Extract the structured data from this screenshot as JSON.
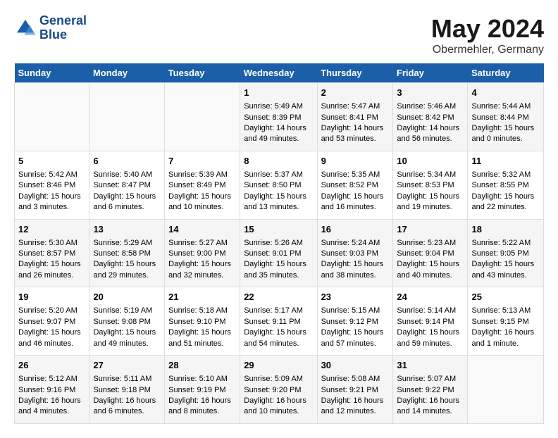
{
  "header": {
    "logo_line1": "General",
    "logo_line2": "Blue",
    "title": "May 2024",
    "subtitle": "Obermehler, Germany"
  },
  "weekdays": [
    "Sunday",
    "Monday",
    "Tuesday",
    "Wednesday",
    "Thursday",
    "Friday",
    "Saturday"
  ],
  "weeks": [
    [
      {
        "day": "",
        "content": ""
      },
      {
        "day": "",
        "content": ""
      },
      {
        "day": "",
        "content": ""
      },
      {
        "day": "1",
        "content": "Sunrise: 5:49 AM\nSunset: 8:39 PM\nDaylight: 14 hours\nand 49 minutes."
      },
      {
        "day": "2",
        "content": "Sunrise: 5:47 AM\nSunset: 8:41 PM\nDaylight: 14 hours\nand 53 minutes."
      },
      {
        "day": "3",
        "content": "Sunrise: 5:46 AM\nSunset: 8:42 PM\nDaylight: 14 hours\nand 56 minutes."
      },
      {
        "day": "4",
        "content": "Sunrise: 5:44 AM\nSunset: 8:44 PM\nDaylight: 15 hours\nand 0 minutes."
      }
    ],
    [
      {
        "day": "5",
        "content": "Sunrise: 5:42 AM\nSunset: 8:46 PM\nDaylight: 15 hours\nand 3 minutes."
      },
      {
        "day": "6",
        "content": "Sunrise: 5:40 AM\nSunset: 8:47 PM\nDaylight: 15 hours\nand 6 minutes."
      },
      {
        "day": "7",
        "content": "Sunrise: 5:39 AM\nSunset: 8:49 PM\nDaylight: 15 hours\nand 10 minutes."
      },
      {
        "day": "8",
        "content": "Sunrise: 5:37 AM\nSunset: 8:50 PM\nDaylight: 15 hours\nand 13 minutes."
      },
      {
        "day": "9",
        "content": "Sunrise: 5:35 AM\nSunset: 8:52 PM\nDaylight: 15 hours\nand 16 minutes."
      },
      {
        "day": "10",
        "content": "Sunrise: 5:34 AM\nSunset: 8:53 PM\nDaylight: 15 hours\nand 19 minutes."
      },
      {
        "day": "11",
        "content": "Sunrise: 5:32 AM\nSunset: 8:55 PM\nDaylight: 15 hours\nand 22 minutes."
      }
    ],
    [
      {
        "day": "12",
        "content": "Sunrise: 5:30 AM\nSunset: 8:57 PM\nDaylight: 15 hours\nand 26 minutes."
      },
      {
        "day": "13",
        "content": "Sunrise: 5:29 AM\nSunset: 8:58 PM\nDaylight: 15 hours\nand 29 minutes."
      },
      {
        "day": "14",
        "content": "Sunrise: 5:27 AM\nSunset: 9:00 PM\nDaylight: 15 hours\nand 32 minutes."
      },
      {
        "day": "15",
        "content": "Sunrise: 5:26 AM\nSunset: 9:01 PM\nDaylight: 15 hours\nand 35 minutes."
      },
      {
        "day": "16",
        "content": "Sunrise: 5:24 AM\nSunset: 9:03 PM\nDaylight: 15 hours\nand 38 minutes."
      },
      {
        "day": "17",
        "content": "Sunrise: 5:23 AM\nSunset: 9:04 PM\nDaylight: 15 hours\nand 40 minutes."
      },
      {
        "day": "18",
        "content": "Sunrise: 5:22 AM\nSunset: 9:05 PM\nDaylight: 15 hours\nand 43 minutes."
      }
    ],
    [
      {
        "day": "19",
        "content": "Sunrise: 5:20 AM\nSunset: 9:07 PM\nDaylight: 15 hours\nand 46 minutes."
      },
      {
        "day": "20",
        "content": "Sunrise: 5:19 AM\nSunset: 9:08 PM\nDaylight: 15 hours\nand 49 minutes."
      },
      {
        "day": "21",
        "content": "Sunrise: 5:18 AM\nSunset: 9:10 PM\nDaylight: 15 hours\nand 51 minutes."
      },
      {
        "day": "22",
        "content": "Sunrise: 5:17 AM\nSunset: 9:11 PM\nDaylight: 15 hours\nand 54 minutes."
      },
      {
        "day": "23",
        "content": "Sunrise: 5:15 AM\nSunset: 9:12 PM\nDaylight: 15 hours\nand 57 minutes."
      },
      {
        "day": "24",
        "content": "Sunrise: 5:14 AM\nSunset: 9:14 PM\nDaylight: 15 hours\nand 59 minutes."
      },
      {
        "day": "25",
        "content": "Sunrise: 5:13 AM\nSunset: 9:15 PM\nDaylight: 16 hours\nand 1 minute."
      }
    ],
    [
      {
        "day": "26",
        "content": "Sunrise: 5:12 AM\nSunset: 9:16 PM\nDaylight: 16 hours\nand 4 minutes."
      },
      {
        "day": "27",
        "content": "Sunrise: 5:11 AM\nSunset: 9:18 PM\nDaylight: 16 hours\nand 6 minutes."
      },
      {
        "day": "28",
        "content": "Sunrise: 5:10 AM\nSunset: 9:19 PM\nDaylight: 16 hours\nand 8 minutes."
      },
      {
        "day": "29",
        "content": "Sunrise: 5:09 AM\nSunset: 9:20 PM\nDaylight: 16 hours\nand 10 minutes."
      },
      {
        "day": "30",
        "content": "Sunrise: 5:08 AM\nSunset: 9:21 PM\nDaylight: 16 hours\nand 12 minutes."
      },
      {
        "day": "31",
        "content": "Sunrise: 5:07 AM\nSunset: 9:22 PM\nDaylight: 16 hours\nand 14 minutes."
      },
      {
        "day": "",
        "content": ""
      }
    ]
  ]
}
